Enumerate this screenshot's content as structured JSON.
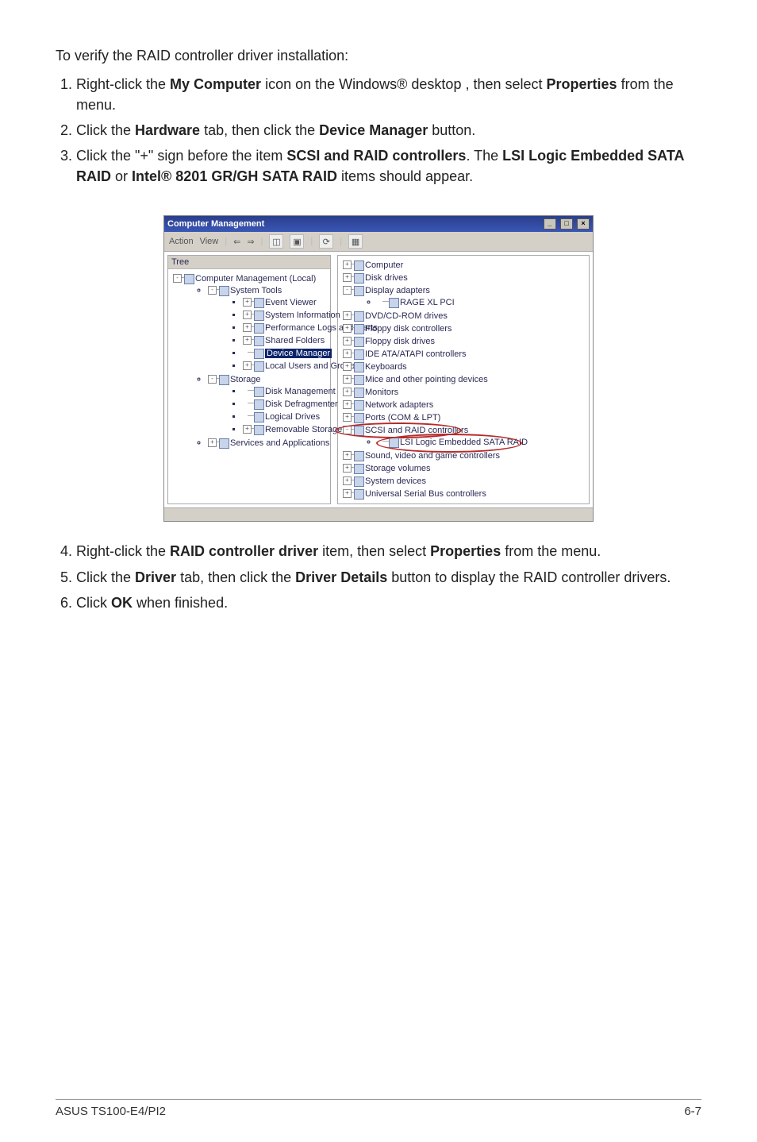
{
  "intro": "To verify the RAID controller driver installation:",
  "steps_a": [
    {
      "prefix": "Right-click the ",
      "b1": "My Computer",
      "mid1": " icon on the Windows® desktop , then select ",
      "b2": "Properties",
      "tail": " from the menu."
    },
    {
      "prefix": "Click the ",
      "b1": "Hardware",
      "mid1": " tab, then click the ",
      "b2": "Device Manager",
      "tail": " button."
    },
    {
      "prefix": "Click the \"+\" sign before the item ",
      "b1": "SCSI and RAID controllers",
      "mid1": ". The ",
      "b2": "LSI Logic Embedded SATA RAID",
      "mid2": " or ",
      "b3": "Intel®  8201 GR/GH SATA RAID",
      "tail": " items should appear."
    }
  ],
  "steps_b": [
    {
      "prefix": "Right-click the ",
      "b1": "RAID controller driver",
      "mid1": " item, then select ",
      "b2": "Properties",
      "tail": " from the menu."
    },
    {
      "prefix": "Click the ",
      "b1": "Driver",
      "mid1": " tab, then click the ",
      "b2": "Driver Details",
      "tail": " button to display the RAID controller drivers."
    },
    {
      "prefix": "Click ",
      "b1": "OK",
      "tail": " when finished."
    }
  ],
  "win": {
    "title": "Computer Management",
    "btn_min": "_",
    "btn_max": "□",
    "btn_close": "×",
    "menu_action": "Action",
    "menu_view": "View",
    "left_header": "Tree",
    "left_root": "Computer Management (Local)",
    "left": {
      "sys_tools": "System Tools",
      "event_viewer": "Event Viewer",
      "sys_info": "System Information",
      "perf_logs": "Performance Logs and Alerts",
      "shared": "Shared Folders",
      "dev_mgr": "Device Manager",
      "local_users": "Local Users and Groups",
      "storage": "Storage",
      "disk_mgmt": "Disk Management",
      "disk_defrag": "Disk Defragmenter",
      "logical_drives": "Logical Drives",
      "removable": "Removable Storage",
      "services": "Services and Applications"
    },
    "right": {
      "computer": "Computer",
      "disk_drives": "Disk drives",
      "display": "Display adapters",
      "display_child": "RAGE XL  PCI",
      "dvd": "DVD/CD-ROM drives",
      "floppy_ctrl": "Floppy disk controllers",
      "floppy_drv": "Floppy disk drives",
      "ide": "IDE ATA/ATAPI controllers",
      "keyboards": "Keyboards",
      "mice": "Mice and other pointing devices",
      "monitors": "Monitors",
      "network": "Network adapters",
      "ports": "Ports (COM & LPT)",
      "scsi": "SCSI and RAID controllers",
      "scsi_child": "LSI Logic Embedded SATA RAID",
      "sound": "Sound, video and game controllers",
      "storage_vol": "Storage volumes",
      "sys_dev": "System devices",
      "usb": "Universal Serial Bus controllers"
    }
  },
  "footer": {
    "left": "ASUS TS100-E4/PI2",
    "right": "6-7"
  }
}
